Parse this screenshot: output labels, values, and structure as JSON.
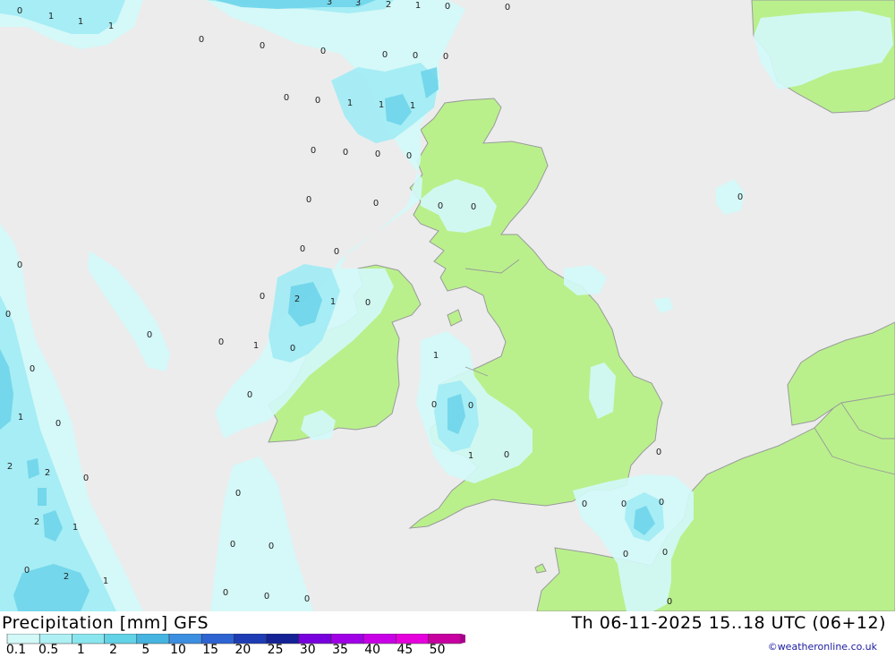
{
  "title": "Precipitation [mm] GFS",
  "datetime": "Th 06-11-2025 15..18 UTC (06+12)",
  "credit": "©weatheronline.co.uk",
  "colors": {
    "sea": "#ececec",
    "land": "#b9f08c",
    "border": "#9a9a9a",
    "precip_light": "#d2f8f8",
    "precip_mid": "#a3ecf4",
    "precip_heavy": "#6fd4ea"
  },
  "legend": {
    "labels": [
      "0.1",
      "0.5",
      "1",
      "2",
      "5",
      "10",
      "15",
      "20",
      "25",
      "30",
      "35",
      "40",
      "45",
      "50"
    ],
    "colors": [
      "#d2f8f8",
      "#aef0f4",
      "#8ae6ee",
      "#62d2e6",
      "#46b4e0",
      "#3c8ee0",
      "#2e64d2",
      "#1e3cb4",
      "#142296",
      "#7800dc",
      "#a000e6",
      "#c800e6",
      "#e600dc",
      "#c800a0"
    ]
  },
  "values": [
    "0",
    "1",
    "1",
    "1",
    "3",
    "3",
    "2",
    "1",
    "0",
    "0",
    "0",
    "0",
    "0",
    "0",
    "0",
    "0",
    "1",
    "1",
    "1",
    "0",
    "0",
    "0",
    "0",
    "0",
    "0",
    "0",
    "0",
    "0",
    "0",
    "0",
    "0",
    "0",
    "0",
    "2",
    "1",
    "0",
    "0",
    "0",
    "1",
    "0",
    "0",
    "0",
    "0",
    "1",
    "0",
    "1",
    "0",
    "0",
    "1",
    "2",
    "2",
    "2",
    "1",
    "0",
    "2",
    "1",
    "0",
    "0",
    "0",
    "0",
    "0",
    "0",
    "0",
    "0",
    "0",
    "0",
    "0",
    "0",
    "0",
    "0",
    "0",
    "0"
  ]
}
